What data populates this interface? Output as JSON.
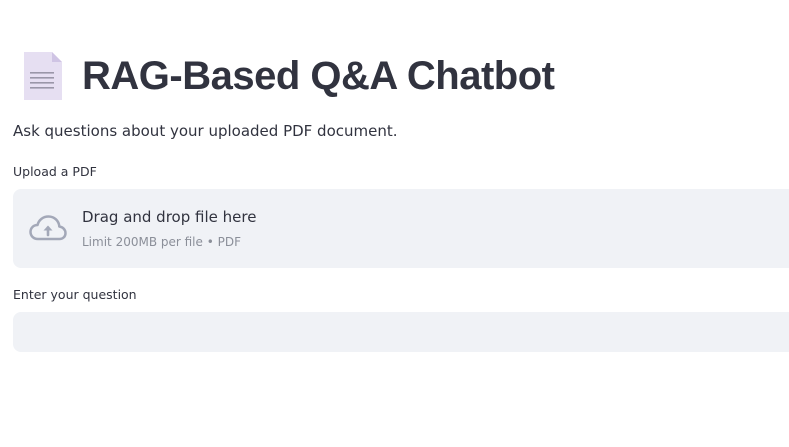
{
  "header": {
    "icon": "document-icon",
    "title": "RAG-Based Q&A Chatbot"
  },
  "subtitle": "Ask questions about your uploaded PDF document.",
  "uploader": {
    "label": "Upload a PDF",
    "icon": "cloud-upload-icon",
    "drop_text": "Drag and drop file here",
    "hint": "Limit 200MB per file • PDF"
  },
  "question": {
    "label": "Enter your question",
    "value": "",
    "placeholder": ""
  },
  "colors": {
    "text": "#31333f",
    "field_background": "#f0f2f6",
    "hint": "#8b8f99",
    "icon": "#a3a8b8"
  }
}
